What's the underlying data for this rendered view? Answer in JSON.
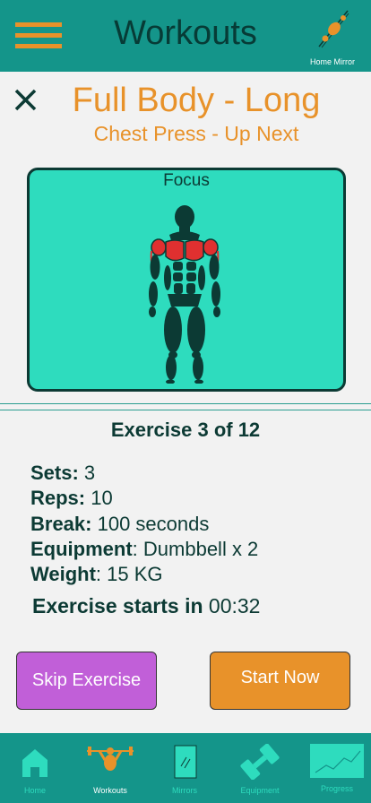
{
  "header": {
    "title": "Workouts",
    "mirror_label": "Home Mirror",
    "menu_icon": "hamburger-menu-icon",
    "mirror_icon": "home-mirror-icon"
  },
  "workout": {
    "title": "Full Body - Long",
    "subtitle": "Chest Press - Up Next",
    "close_icon": "close-icon"
  },
  "focus": {
    "label": "Focus",
    "highlighted_muscles": [
      "chest",
      "shoulders"
    ]
  },
  "exercise": {
    "progress": "Exercise 3 of 12",
    "sets_label": "Sets:",
    "sets_value": " 3",
    "reps_label": "Reps:",
    "reps_value": " 10",
    "break_label": "Break:",
    "break_value": " 100 seconds",
    "equipment_label": "Equipment",
    "equipment_value": ": Dumbbell x 2",
    "weight_label": "Weight",
    "weight_value": ": 15 KG",
    "starts_label": "Exercise starts in",
    "starts_value": " 00:32"
  },
  "actions": {
    "skip": "Skip Exercise",
    "start": "Start Now"
  },
  "tabs": [
    {
      "label": "Home",
      "icon": "home-icon",
      "active": false
    },
    {
      "label": "Workouts",
      "icon": "weightlifter-icon",
      "active": true
    },
    {
      "label": "Mirrors",
      "icon": "mirror-icon",
      "active": false
    },
    {
      "label": "Equipment",
      "icon": "dumbbell-icon",
      "active": false
    },
    {
      "label": "Progress",
      "icon": "progress-chart-icon",
      "active": false
    }
  ],
  "colors": {
    "primary": "#14958a",
    "accent": "#e8922a",
    "focus_bg": "#2edcbe",
    "dark": "#0c3a34",
    "skip": "#c15fd8",
    "muscle_highlight": "#e03030"
  }
}
